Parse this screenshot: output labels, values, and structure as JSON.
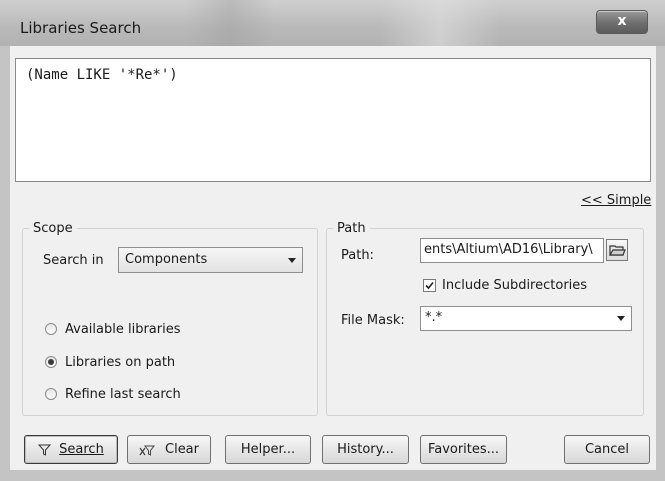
{
  "window": {
    "title": "Libraries Search",
    "close_glyph": "x"
  },
  "query": {
    "text": "(Name LIKE '*Re*')"
  },
  "mode_link": "<< Simple",
  "scope": {
    "legend": "Scope",
    "search_in_label": "Search in",
    "search_in_value": "Components",
    "options": [
      {
        "label": "Available libraries",
        "checked": false
      },
      {
        "label": "Libraries on path",
        "checked": true
      },
      {
        "label": "Refine last search",
        "checked": false
      }
    ]
  },
  "path_group": {
    "legend": "Path",
    "path_label": "Path:",
    "path_value": "ents\\Altium\\AD16\\Library\\",
    "include_subdirs_label": "Include Subdirectories",
    "include_subdirs_checked": true,
    "file_mask_label": "File Mask:",
    "file_mask_value": "*.*"
  },
  "buttons": {
    "search": "Search",
    "clear": "Clear",
    "helper": "Helper...",
    "history": "History...",
    "favorites": "Favorites...",
    "cancel": "Cancel"
  },
  "icons": [
    "close-icon",
    "chevron-down-icon",
    "folder-open-icon",
    "checkmark-icon",
    "filter-funnel-icon",
    "clear-filter-icon"
  ]
}
